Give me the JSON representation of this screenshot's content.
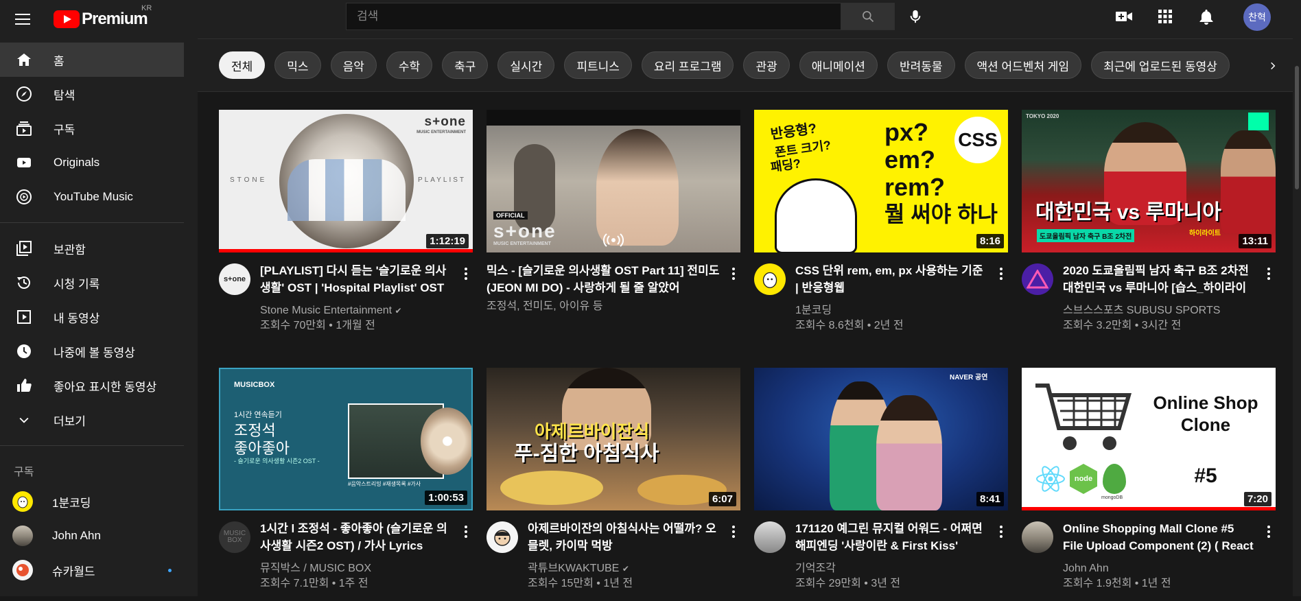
{
  "header": {
    "logo_text": "Premium",
    "region": "KR",
    "search_placeholder": "검색",
    "avatar_text": "찬혁"
  },
  "sidebar": {
    "main": [
      {
        "label": "홈",
        "icon": "home-icon"
      },
      {
        "label": "탐색",
        "icon": "compass-icon"
      },
      {
        "label": "구독",
        "icon": "subscriptions-icon"
      },
      {
        "label": "Originals",
        "icon": "originals-icon"
      },
      {
        "label": "YouTube Music",
        "icon": "music-icon"
      }
    ],
    "library": [
      {
        "label": "보관함",
        "icon": "library-icon"
      },
      {
        "label": "시청 기록",
        "icon": "history-icon"
      },
      {
        "label": "내 동영상",
        "icon": "my-videos-icon"
      },
      {
        "label": "나중에 볼 동영상",
        "icon": "watch-later-icon"
      },
      {
        "label": "좋아요 표시한 동영상",
        "icon": "thumbs-up-icon"
      },
      {
        "label": "더보기",
        "icon": "chevron-down-icon"
      }
    ],
    "subscriptions_heading": "구독",
    "subscriptions": [
      {
        "label": "1분코딩"
      },
      {
        "label": "John Ahn"
      },
      {
        "label": "슈카월드"
      }
    ]
  },
  "chips": [
    "전체",
    "믹스",
    "음악",
    "수학",
    "축구",
    "실시간",
    "피트니스",
    "요리 프로그램",
    "관광",
    "애니메이션",
    "반려동물",
    "액션 어드벤처 게임",
    "최근에 업로드된 동영상"
  ],
  "videos": [
    {
      "title": "[PLAYLIST] 다시 듣는 '슬기로운 의사생활' OST | 'Hospital Playlist' OST",
      "channel": "Stone Music Entertainment",
      "verified": true,
      "stats": "조회수 70만회 • 1개월 전",
      "duration": "1:12:19",
      "progress": 1.0,
      "avatar_text": "s+one",
      "thumb_text_top": "s+one",
      "thumb_text_sub": "MUSIC ENTERTAINMENT",
      "thumb_left": "STONE",
      "thumb_right": "PLAYLIST"
    },
    {
      "title": "믹스 - [슬기로운 의사생활 OST Part 11] 전미도 (JEON MI DO) - 사랑하게 될 줄 알았어",
      "channel": "조정석, 전미도, 아이유 등",
      "verified": false,
      "stats": "",
      "duration": "",
      "progress": 0,
      "thumb_official": "OFFICIAL",
      "thumb_brand": "s+one",
      "thumb_brand_sub": "MUSIC ENTERTAINMENT"
    },
    {
      "title": "CSS 단위 rem, em, px 사용하는 기준 | 반응형웹",
      "channel": "1분코딩",
      "verified": false,
      "stats": "조회수 8.6천회 • 2년 전",
      "duration": "8:16",
      "progress": 0,
      "thumb_q1": "반응형?",
      "thumb_q2": "폰트 크기?",
      "thumb_q3": "패딩?",
      "thumb_main1": "px?",
      "thumb_main2": "em?",
      "thumb_main3": "rem?",
      "thumb_main4": "뭘 써야 하나",
      "thumb_badge": "CSS"
    },
    {
      "title": "2020 도쿄올림픽 남자 축구 B조 2차전 대한민국 vs 루마니아 [습스_하이라이트]",
      "channel": "스브스스포츠 SUBUSU SPORTS",
      "verified": false,
      "stats": "조회수 3.2만회 • 3시간 전",
      "duration": "13:11",
      "progress": 0,
      "thumb_big": "대한민국 vs 루마니아",
      "thumb_small": "도쿄올림픽 남자 축구 B조 2차전",
      "thumb_tag": "하이라이트",
      "thumb_corner": "TOKYO 2020"
    },
    {
      "title": "1시간 l 조정석 - 좋아좋아 (슬기로운 의사생활 시즌2 OST) / 가사 Lyrics",
      "channel": "뮤직박스 / MUSIC BOX",
      "verified": false,
      "stats": "조회수 7.1만회 • 1주 전",
      "duration": "1:00:53",
      "progress": 0,
      "avatar_text": "MUSIC BOX",
      "thumb_brand": "MUSICBOX",
      "thumb_l1": "1시간 연속듣기",
      "thumb_l2": "조정석",
      "thumb_l3": "좋아좋아",
      "thumb_l4": "- 슬기로운 의사생활 시즌2 OST -",
      "thumb_tags": "#음악스트리밍 #재생목록 #가사"
    },
    {
      "title": "아제르바이잔의 아침식사는 어떨까? 오믈렛, 카이막 먹방",
      "channel": "곽튜브KWAKTUBE",
      "verified": true,
      "stats": "조회수 15만회 • 1년 전",
      "duration": "6:07",
      "progress": 0,
      "thumb_l1": "아제르바이잔식",
      "thumb_l2": "푸-짐한 아침식사"
    },
    {
      "title": "171120 예그린 뮤지컬 어워드 - 어쩌면 해피엔딩 '사랑이란 & First Kiss'",
      "channel": "기억조각",
      "verified": false,
      "stats": "조회수 29만회 • 3년 전",
      "duration": "8:41",
      "progress": 0,
      "thumb_tag": "NAVER 공연"
    },
    {
      "title": "Online Shopping Mall Clone #5 File Upload Component (2) ( React )",
      "channel": "John Ahn",
      "verified": false,
      "stats": "조회수 1.9천회 • 1년 전",
      "duration": "7:20",
      "progress": 1.0,
      "thumb_l1": "Online Shop",
      "thumb_l2": "Clone",
      "thumb_l3": "#5",
      "thumb_node": "node",
      "thumb_mongo": "mongoDB"
    }
  ],
  "colors": {
    "accent": "#ff0000",
    "background": "#181818",
    "panel": "#202020",
    "live_dot": "#3ea6ff"
  }
}
